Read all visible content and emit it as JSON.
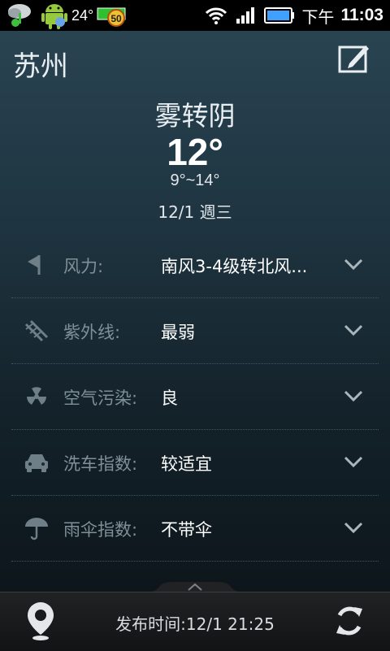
{
  "status_bar": {
    "temperature": "24°",
    "battery_badge": "50",
    "period": "下午",
    "time": "11:03"
  },
  "header": {
    "city": "苏州",
    "edit_icon": "edit-icon"
  },
  "summary": {
    "condition": "雾转阴",
    "temperature": "12°",
    "range": "9°~14°",
    "date": "12/1 週三"
  },
  "details": [
    {
      "icon": "wind-flag-icon",
      "label": "风力:",
      "value": "南风3-4级转北风..."
    },
    {
      "icon": "uv-icon",
      "label": "紫外线:",
      "value": "最弱"
    },
    {
      "icon": "radiation-icon",
      "label": "空气污染:",
      "value": "良"
    },
    {
      "icon": "car-icon",
      "label": "洗车指数:",
      "value": "较适宜"
    },
    {
      "icon": "umbrella-icon",
      "label": "雨伞指数:",
      "value": "不带伞"
    }
  ],
  "footer": {
    "publish_time": "发布时间:12/1 21:25",
    "location_icon": "location-pin-icon",
    "refresh_icon": "refresh-icon"
  },
  "colors": {
    "label": "#7f9099",
    "value": "#ffffff",
    "background_top": "#2b4654",
    "background_bottom": "#0b1216"
  }
}
